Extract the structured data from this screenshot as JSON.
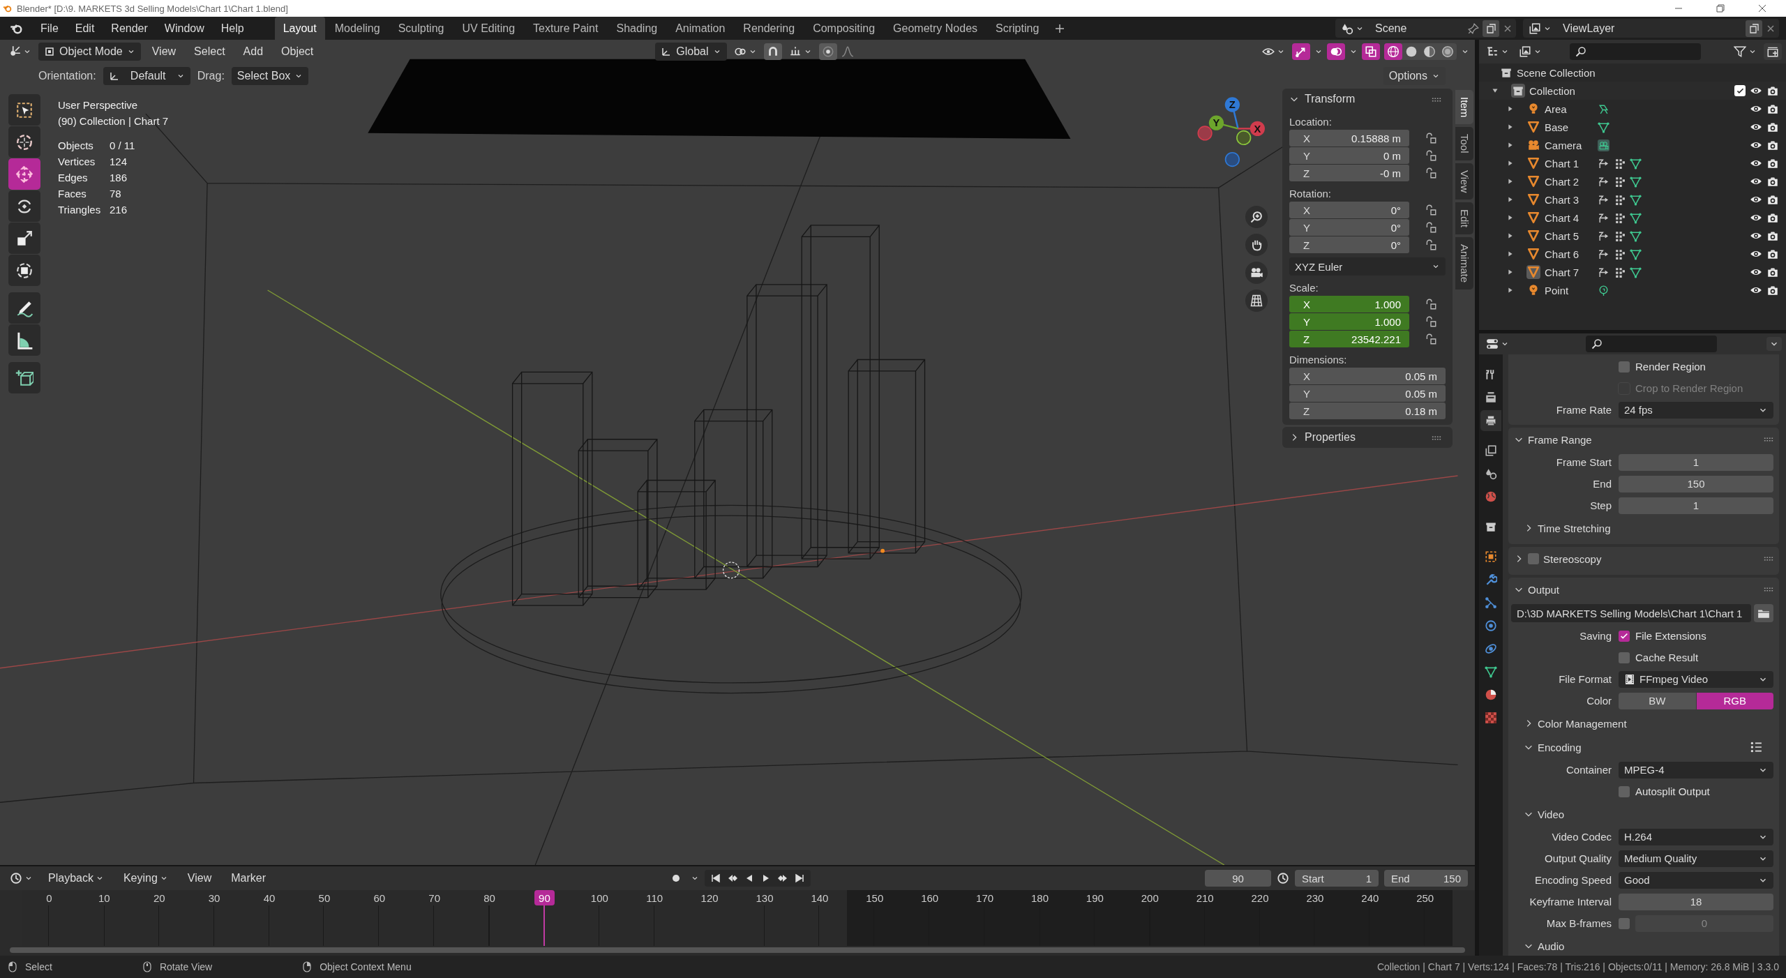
{
  "window": {
    "title": "Blender* [D:\\9. MARKETS 3d Selling Models\\Chart 1\\Chart 1.blend]"
  },
  "top_bar": {
    "menus": [
      "File",
      "Edit",
      "Render",
      "Window",
      "Help"
    ],
    "workspaces": [
      {
        "label": "Layout",
        "selected": true
      },
      {
        "label": "Modeling",
        "selected": false
      },
      {
        "label": "Sculpting",
        "selected": false
      },
      {
        "label": "UV Editing",
        "selected": false
      },
      {
        "label": "Texture Paint",
        "selected": false
      },
      {
        "label": "Shading",
        "selected": false
      },
      {
        "label": "Animation",
        "selected": false
      },
      {
        "label": "Rendering",
        "selected": false
      },
      {
        "label": "Compositing",
        "selected": false
      },
      {
        "label": "Geometry Nodes",
        "selected": false
      },
      {
        "label": "Scripting",
        "selected": false
      }
    ],
    "scene": "Scene",
    "view_layer": "ViewLayer"
  },
  "viewport": {
    "header": {
      "mode": "Object Mode",
      "menus": [
        "View",
        "Select",
        "Add",
        "Object"
      ],
      "orientation": "Global",
      "gizmos_on": true,
      "overlays_on": true,
      "xray_on": true,
      "shading": [
        {
          "kind": "wireframe",
          "selected": true
        },
        {
          "kind": "solid",
          "selected": false
        },
        {
          "kind": "material",
          "selected": false
        },
        {
          "kind": "rendered",
          "selected": false
        }
      ]
    },
    "tool_settings": {
      "orientation_label": "Orientation:",
      "orientation": "Default",
      "drag_label": "Drag:",
      "drag": "Select Box",
      "options": "Options"
    },
    "tools": [
      {
        "kind": "select-box",
        "selected": false
      },
      {
        "kind": "cursor",
        "selected": false
      },
      {
        "kind": "move",
        "selected": true
      },
      {
        "kind": "rotate",
        "selected": false
      },
      {
        "kind": "scale",
        "selected": false
      },
      {
        "kind": "transform",
        "selected": false
      },
      {
        "kind": "annotate",
        "selected": false
      },
      {
        "kind": "measure",
        "selected": false
      },
      {
        "kind": "add-cube",
        "selected": false
      }
    ],
    "info": {
      "view": "User Perspective",
      "context": "(90) Collection | Chart 7",
      "stats": [
        {
          "label": "Objects",
          "value": "0 / 11"
        },
        {
          "label": "Vertices",
          "value": "124"
        },
        {
          "label": "Edges",
          "value": "186"
        },
        {
          "label": "Faces",
          "value": "78"
        },
        {
          "label": "Triangles",
          "value": "216"
        }
      ]
    },
    "gizmo_axes": [
      "Z",
      "Y",
      "X"
    ]
  },
  "sidebar": {
    "tabs": [
      {
        "label": "Item",
        "selected": true
      },
      {
        "label": "Tool",
        "selected": false
      },
      {
        "label": "View",
        "selected": false
      },
      {
        "label": "Edit",
        "selected": false
      },
      {
        "label": "Animate",
        "selected": false
      }
    ],
    "transform": {
      "title": "Transform",
      "expanded": true,
      "groups": [
        {
          "kind": "locked-vector",
          "label": "Location:",
          "animated": false,
          "fields": [
            {
              "axis": "X",
              "value": "0.15888 m"
            },
            {
              "axis": "Y",
              "value": "0 m"
            },
            {
              "axis": "Z",
              "value": "-0 m"
            }
          ]
        },
        {
          "kind": "locked-vector",
          "label": "Rotation:",
          "animated": false,
          "fields": [
            {
              "axis": "X",
              "value": "0°"
            },
            {
              "axis": "Y",
              "value": "0°"
            },
            {
              "axis": "Z",
              "value": "0°"
            }
          ]
        },
        {
          "kind": "dropdown",
          "value": "XYZ Euler"
        },
        {
          "kind": "locked-vector",
          "label": "Scale:",
          "animated": true,
          "fields": [
            {
              "axis": "X",
              "value": "1.000"
            },
            {
              "axis": "Y",
              "value": "1.000"
            },
            {
              "axis": "Z",
              "value": "23542.221"
            }
          ]
        },
        {
          "kind": "vector",
          "label": "Dimensions:",
          "animated": false,
          "fields": [
            {
              "axis": "X",
              "value": "0.05 m"
            },
            {
              "axis": "Y",
              "value": "0.05 m"
            },
            {
              "axis": "Z",
              "value": "0.18 m"
            }
          ]
        }
      ]
    },
    "properties_panel": {
      "title": "Properties",
      "expanded": false
    }
  },
  "outliner": {
    "root": "Scene Collection",
    "items": [
      {
        "name": "Collection",
        "kind": "collection",
        "expanded": true,
        "checked": true,
        "children": [
          {
            "name": "Area",
            "kind": "area-light",
            "expanded": false,
            "active": false
          },
          {
            "name": "Base",
            "kind": "mesh",
            "expanded": false,
            "active": false
          },
          {
            "name": "Camera",
            "kind": "camera",
            "expanded": false,
            "active": false
          },
          {
            "name": "Chart 1",
            "kind": "animated-mesh",
            "expanded": false,
            "active": false
          },
          {
            "name": "Chart 2",
            "kind": "animated-mesh",
            "expanded": false,
            "active": false
          },
          {
            "name": "Chart 3",
            "kind": "animated-mesh",
            "expanded": false,
            "active": false
          },
          {
            "name": "Chart 4",
            "kind": "animated-mesh",
            "expanded": false,
            "active": false
          },
          {
            "name": "Chart 5",
            "kind": "animated-mesh",
            "expanded": false,
            "active": false
          },
          {
            "name": "Chart 6",
            "kind": "animated-mesh",
            "expanded": false,
            "active": false
          },
          {
            "name": "Chart 7",
            "kind": "animated-mesh",
            "expanded": false,
            "active": true
          },
          {
            "name": "Point",
            "kind": "point-light",
            "expanded": false,
            "active": false
          }
        ]
      }
    ]
  },
  "properties": {
    "tabs": [
      {
        "kind": "tool",
        "selected": false
      },
      {
        "kind": "render",
        "selected": false
      },
      {
        "kind": "output",
        "selected": true
      },
      {
        "kind": "view-layer",
        "selected": false
      },
      {
        "kind": "scene",
        "selected": false
      },
      {
        "kind": "world",
        "selected": false
      },
      {
        "kind": "collection",
        "selected": false
      },
      {
        "kind": "object",
        "selected": false
      },
      {
        "kind": "modifier",
        "selected": false
      },
      {
        "kind": "particles",
        "selected": false
      },
      {
        "kind": "physics",
        "selected": false
      },
      {
        "kind": "constraints",
        "selected": false
      },
      {
        "kind": "data",
        "selected": false
      },
      {
        "kind": "material",
        "selected": false
      },
      {
        "kind": "texture",
        "selected": false
      }
    ],
    "sections": [
      {
        "kind": "continuation",
        "rows": [
          {
            "kind": "checkbox",
            "text": "Render Region",
            "checked": false,
            "disabled": false
          },
          {
            "kind": "checkbox",
            "text": "Crop to Render Region",
            "checked": false,
            "disabled": true
          },
          {
            "kind": "dropdown",
            "label": "Frame Rate",
            "value": "24 fps"
          }
        ]
      },
      {
        "kind": "panel",
        "title": "Frame Range",
        "expanded": true,
        "rows": [
          {
            "kind": "number",
            "label": "Frame Start",
            "value": "1"
          },
          {
            "kind": "number",
            "label": "End",
            "value": "150"
          },
          {
            "kind": "number",
            "label": "Step",
            "value": "1"
          },
          {
            "kind": "subpanel",
            "title": "Time Stretching",
            "expanded": false
          }
        ]
      },
      {
        "kind": "toggle-panel",
        "title": "Stereoscopy",
        "expanded": false,
        "checked": false
      },
      {
        "kind": "panel",
        "title": "Output",
        "expanded": true,
        "rows": [
          {
            "kind": "path",
            "value": "D:\\3D MARKETS Selling Models\\Chart 1\\Chart 1"
          },
          {
            "kind": "checkbox",
            "label": "Saving",
            "text": "File Extensions",
            "checked": true,
            "disabled": false
          },
          {
            "kind": "checkbox",
            "text": "Cache Result",
            "checked": false,
            "disabled": false
          },
          {
            "kind": "media-dropdown",
            "label": "File Format",
            "value": "FFmpeg Video"
          },
          {
            "kind": "segmented",
            "label": "Color",
            "options": [
              {
                "label": "BW",
                "selected": false
              },
              {
                "label": "RGB",
                "selected": true
              }
            ]
          },
          {
            "kind": "subpanel",
            "title": "Color Management",
            "expanded": false
          },
          {
            "kind": "subpanel",
            "title": "Encoding",
            "expanded": true,
            "presets": true,
            "rows": [
              {
                "kind": "dropdown",
                "label": "Container",
                "value": "MPEG-4"
              },
              {
                "kind": "checkbox",
                "text": "Autosplit Output",
                "checked": false,
                "disabled": false
              }
            ]
          },
          {
            "kind": "subpanel",
            "title": "Video",
            "expanded": true,
            "rows": [
              {
                "kind": "dropdown",
                "label": "Video Codec",
                "value": "H.264"
              },
              {
                "kind": "dropdown",
                "label": "Output Quality",
                "value": "Medium Quality"
              },
              {
                "kind": "dropdown",
                "label": "Encoding Speed",
                "value": "Good"
              },
              {
                "kind": "number",
                "label": "Keyframe Interval",
                "value": "18"
              },
              {
                "kind": "checkbox-number",
                "label": "Max B-frames",
                "checked": false,
                "value": "0"
              }
            ]
          },
          {
            "kind": "subpanel",
            "title": "Audio",
            "expanded": true
          }
        ]
      }
    ]
  },
  "timeline": {
    "menus": [
      "Playback",
      "Keying",
      "View",
      "Marker"
    ],
    "auto_keying": false,
    "current_frame": "90",
    "start_label": "Start",
    "start": "1",
    "end_label": "End",
    "end": "150",
    "ticks": [
      {
        "label": "0",
        "selected": false,
        "in_range": true
      },
      {
        "label": "10",
        "selected": false,
        "in_range": true
      },
      {
        "label": "20",
        "selected": false,
        "in_range": true
      },
      {
        "label": "30",
        "selected": false,
        "in_range": true
      },
      {
        "label": "40",
        "selected": false,
        "in_range": true
      },
      {
        "label": "50",
        "selected": false,
        "in_range": true
      },
      {
        "label": "60",
        "selected": false,
        "in_range": true
      },
      {
        "label": "70",
        "selected": false,
        "in_range": true
      },
      {
        "label": "80",
        "selected": false,
        "in_range": true
      },
      {
        "label": "90",
        "selected": true,
        "in_range": true
      },
      {
        "label": "100",
        "selected": false,
        "in_range": true
      },
      {
        "label": "110",
        "selected": false,
        "in_range": true
      },
      {
        "label": "120",
        "selected": false,
        "in_range": true
      },
      {
        "label": "130",
        "selected": false,
        "in_range": true
      },
      {
        "label": "140",
        "selected": false,
        "in_range": true
      },
      {
        "label": "150",
        "selected": false,
        "in_range": false
      },
      {
        "label": "160",
        "selected": false,
        "in_range": false
      },
      {
        "label": "170",
        "selected": false,
        "in_range": false
      },
      {
        "label": "180",
        "selected": false,
        "in_range": false
      },
      {
        "label": "190",
        "selected": false,
        "in_range": false
      },
      {
        "label": "200",
        "selected": false,
        "in_range": false
      },
      {
        "label": "210",
        "selected": false,
        "in_range": false
      },
      {
        "label": "220",
        "selected": false,
        "in_range": false
      },
      {
        "label": "230",
        "selected": false,
        "in_range": false
      },
      {
        "label": "240",
        "selected": false,
        "in_range": false
      },
      {
        "label": "250",
        "selected": false,
        "in_range": false
      }
    ]
  },
  "status_bar": {
    "hints": [
      {
        "kind": "left-mouse",
        "label": "Select"
      },
      {
        "kind": "middle-mouse",
        "label": "Rotate View"
      },
      {
        "kind": "right-mouse",
        "label": "Object Context Menu"
      }
    ],
    "info": "Collection | Chart 7 | Verts:124 | Faces:78 | Tris:216 | Objects:0/11 | Memory: 26.8 MiB | 3.3.0"
  }
}
